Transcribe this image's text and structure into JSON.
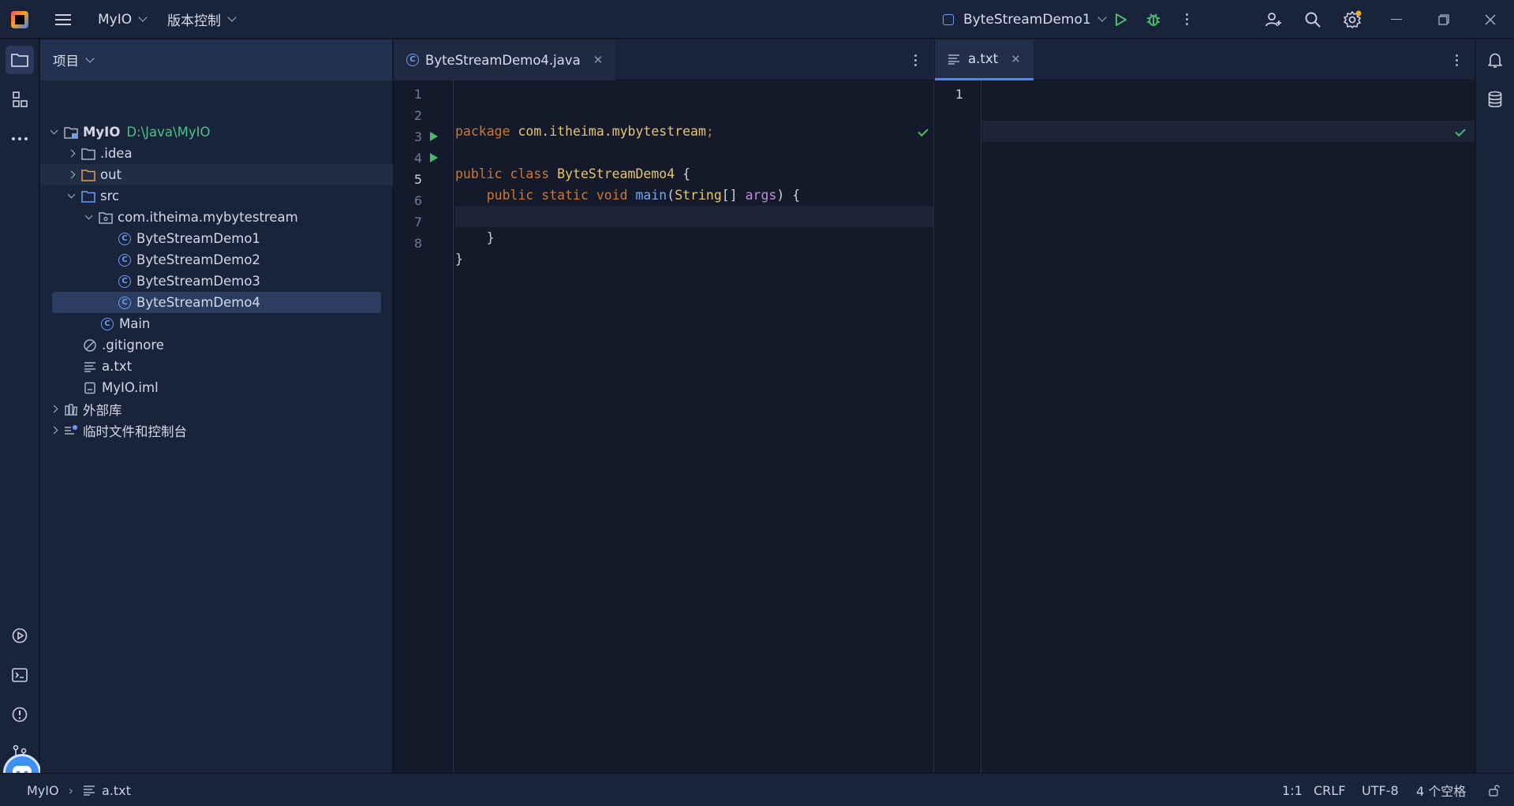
{
  "titlebar": {
    "project_name": "MyIO",
    "vcs_label": "版本控制",
    "run_config": "ByteStreamDemo1"
  },
  "project_panel": {
    "title": "项目",
    "tree": [
      {
        "label": "MyIO",
        "extra": "D:\\Java\\MyIO",
        "level": 0,
        "expanded": true,
        "icon": "module-folder-icon"
      },
      {
        "label": ".idea",
        "level": 1,
        "expanded": false,
        "icon": "folder-icon"
      },
      {
        "label": "out",
        "level": 1,
        "expanded": false,
        "icon": "folder-excluded-icon"
      },
      {
        "label": "src",
        "level": 1,
        "expanded": true,
        "icon": "source-folder-icon"
      },
      {
        "label": "com.itheima.mybytestream",
        "level": 2,
        "expanded": true,
        "icon": "package-icon"
      },
      {
        "label": "ByteStreamDemo1",
        "level": 3,
        "icon": "java-class-icon"
      },
      {
        "label": "ByteStreamDemo2",
        "level": 3,
        "icon": "java-class-icon"
      },
      {
        "label": "ByteStreamDemo3",
        "level": 3,
        "icon": "java-class-icon"
      },
      {
        "label": "ByteStreamDemo4",
        "level": 3,
        "icon": "java-class-icon",
        "selected": true
      },
      {
        "label": "Main",
        "level": 2,
        "icon": "java-class-icon"
      },
      {
        "label": ".gitignore",
        "level": 1,
        "icon": "ignore-file-icon"
      },
      {
        "label": "a.txt",
        "level": 1,
        "icon": "text-file-icon"
      },
      {
        "label": "MyIO.iml",
        "level": 1,
        "icon": "iml-file-icon"
      },
      {
        "label": "外部库",
        "level": 0,
        "expanded": false,
        "icon": "library-icon"
      },
      {
        "label": "临时文件和控制台",
        "level": 0,
        "expanded": false,
        "icon": "scratches-icon"
      }
    ]
  },
  "editor_left": {
    "tab_label": "ByteStreamDemo4.java",
    "line_numbers": [
      "1",
      "2",
      "3",
      "4",
      "5",
      "6",
      "7",
      "8"
    ]
  },
  "editor_right": {
    "tab_label": "a.txt",
    "line_numbers": [
      "1"
    ]
  },
  "status": {
    "crumb_project": "MyIO",
    "crumb_file": "a.txt",
    "caret": "1:1",
    "line_sep": "CRLF",
    "encoding": "UTF-8",
    "indent": "4 个空格"
  }
}
